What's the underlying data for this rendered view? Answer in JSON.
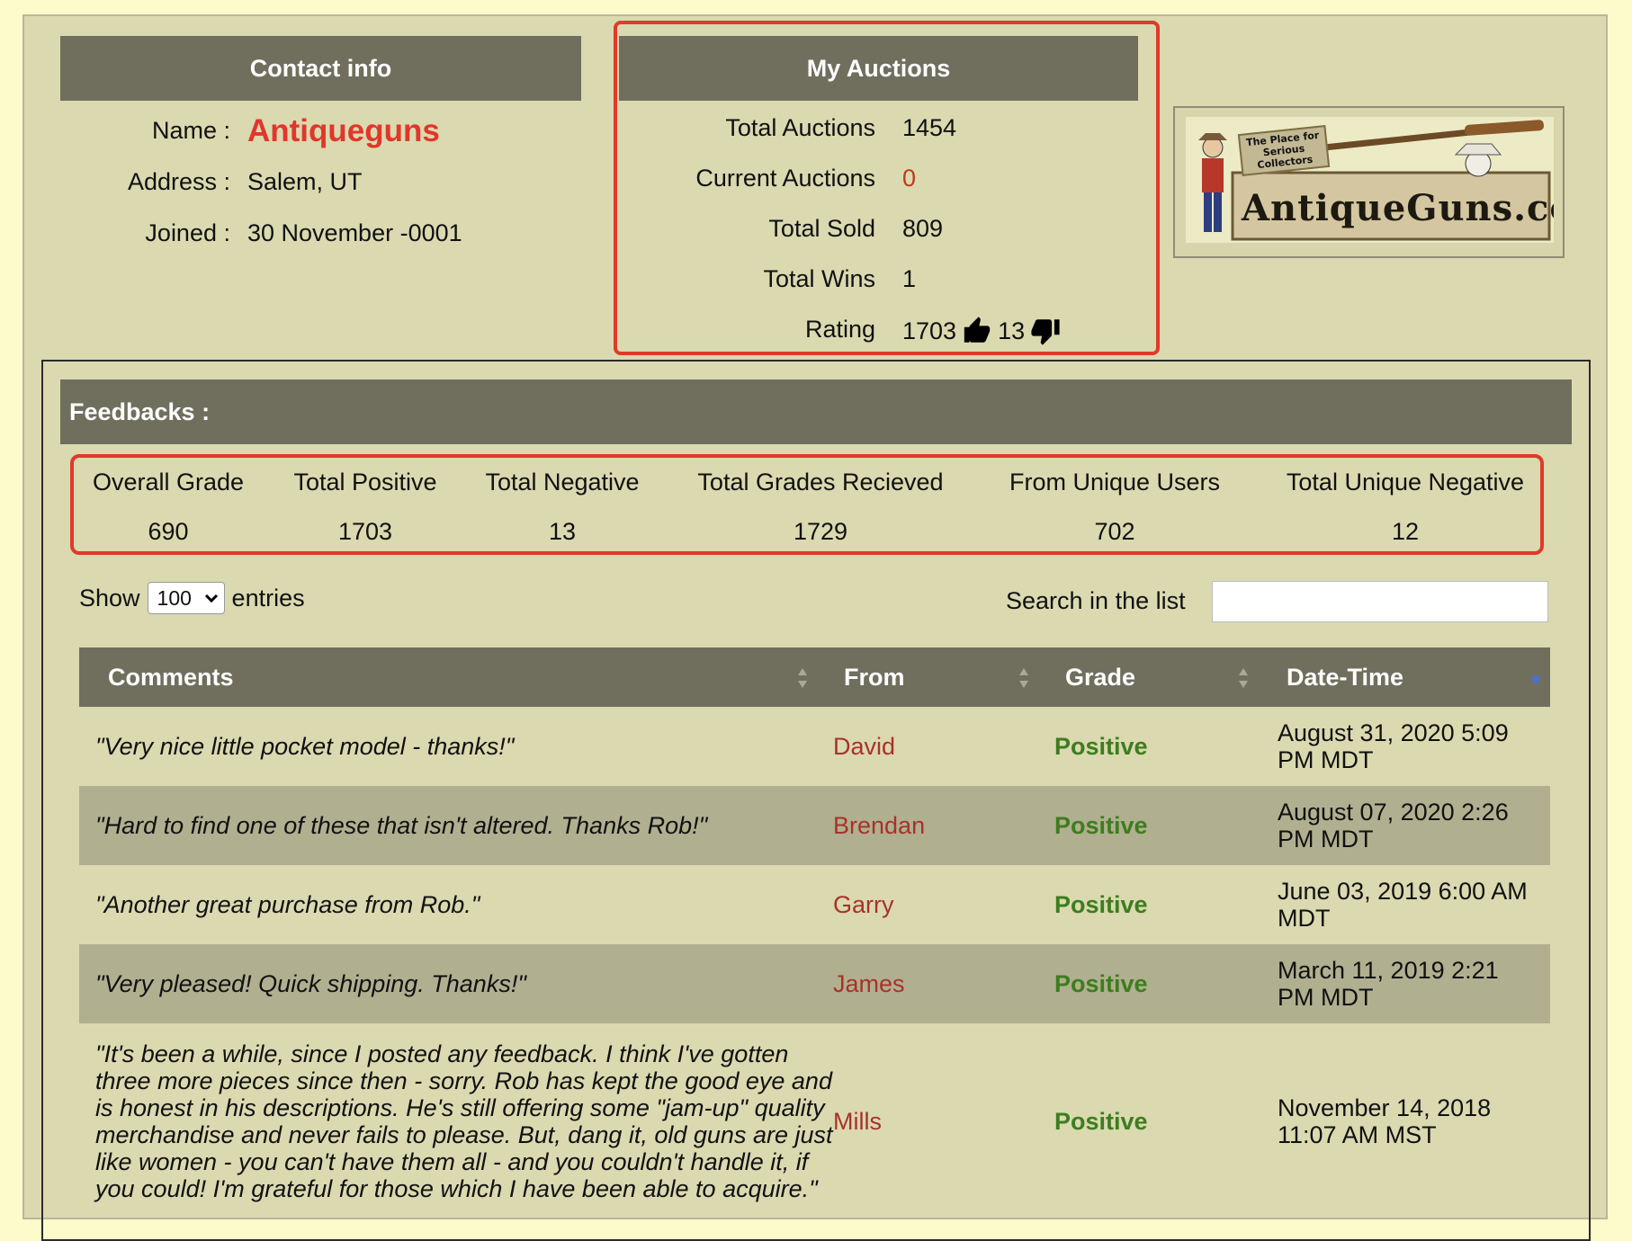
{
  "contact": {
    "title": "Contact info",
    "name_label": "Name :",
    "name_value": "Antiqueguns",
    "address_label": "Address :",
    "address_value": "Salem, UT",
    "joined_label": "Joined :",
    "joined_value": "30 November -0001"
  },
  "auctions": {
    "title": "My Auctions",
    "rows": [
      {
        "label": "Total Auctions",
        "value": "1454"
      },
      {
        "label": "Current Auctions",
        "value": "0"
      },
      {
        "label": "Total Sold",
        "value": "809"
      },
      {
        "label": "Total Wins",
        "value": "1"
      }
    ],
    "rating_label": "Rating",
    "rating_positive": "1703",
    "rating_negative": "13"
  },
  "logo": {
    "text": "AntiqueGuns.com",
    "tagline": "The Place for Serious Collectors"
  },
  "feedbacks": {
    "title": "Feedbacks :",
    "grades": [
      {
        "label": "Overall Grade",
        "value": "690"
      },
      {
        "label": "Total Positive",
        "value": "1703"
      },
      {
        "label": "Total Negative",
        "value": "13"
      },
      {
        "label": "Total Grades Recieved",
        "value": "1729"
      },
      {
        "label": "From Unique Users",
        "value": "702"
      },
      {
        "label": "Total Unique Negative",
        "value": "12"
      }
    ],
    "show_label": "Show",
    "entries_value": "100",
    "entries_label": "entries",
    "search_label": "Search in the list",
    "search_value": "",
    "columns": [
      "Comments",
      "From",
      "Grade",
      "Date-Time"
    ],
    "rows": [
      {
        "comment": "\"Very nice little pocket model - thanks!\"",
        "from": "David",
        "grade": "Positive",
        "date": "August 31, 2020 5:09 PM MDT"
      },
      {
        "comment": "\"Hard to find one of these that isn't altered. Thanks Rob!\"",
        "from": "Brendan",
        "grade": "Positive",
        "date": "August 07, 2020 2:26 PM MDT"
      },
      {
        "comment": "\"Another great purchase from Rob.\"",
        "from": "Garry",
        "grade": "Positive",
        "date": "June 03, 2019 6:00 AM MDT"
      },
      {
        "comment": "\"Very pleased! Quick shipping. Thanks!\"",
        "from": "James",
        "grade": "Positive",
        "date": "March 11, 2019 2:21 PM MDT"
      },
      {
        "comment": "\"It's been a while, since I posted any feedback. I think I've gotten three more pieces since then - sorry. Rob has kept the good eye and is honest in his descriptions. He's still offering some \"jam-up\" quality merchandise and never fails to please. But, dang it, old guns are just like women - you can't have them all - and you couldn't handle it, if you could! I'm grateful for those which I have been able to acquire.\"",
        "from": "Mills",
        "grade": "Positive",
        "date": "November 14, 2018 11:07 AM MST"
      }
    ]
  },
  "colors": {
    "page_bg": "#fdfacb",
    "panel_bg": "#dad9b0",
    "header_bg": "#706f5e",
    "highlight_border": "#e03a2a",
    "name_color": "#e0372a",
    "from_color": "#a8322a",
    "grade_color": "#3e7d1e"
  },
  "icons": {
    "rating_positive": "thumbs-up-icon",
    "rating_negative": "thumbs-down-icon",
    "sort": "sort-icon",
    "select_arrow": "chevron-down-icon"
  }
}
